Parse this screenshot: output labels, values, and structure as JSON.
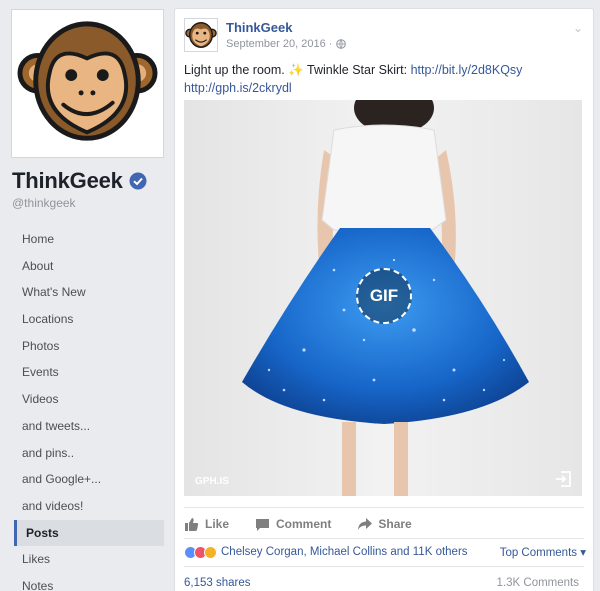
{
  "page": {
    "name": "ThinkGeek",
    "handle": "@thinkgeek"
  },
  "nav": {
    "items": [
      "Home",
      "About",
      "What's New",
      "Locations",
      "Photos",
      "Events",
      "Videos",
      "and tweets...",
      "and pins..",
      "and Google+...",
      "and videos!",
      "Posts",
      "Likes",
      "Notes"
    ],
    "active": "Posts"
  },
  "post": {
    "author": "ThinkGeek",
    "date": "September 20, 2016 ·",
    "text_before": "Light up the room. ",
    "emoji": "✨",
    "text_middle": " Twinkle Star Skirt: ",
    "link1": "http://bit.ly/2d8KQsy",
    "link2": "http://gph.is/2ckrydl",
    "media_badge": "GIF",
    "media_source": "GPH.IS"
  },
  "actions": {
    "like": "Like",
    "comment": "Comment",
    "share": "Share"
  },
  "reactions": {
    "summary": "Chelsey Corgan, Michael Collins and 11K others",
    "top_comments": "Top Comments ▾",
    "shares": "6,153 shares",
    "comments": "1.3K Comments"
  },
  "colors": {
    "brand_blue": "#4267b2",
    "link_blue": "#365899",
    "like_blue": "#5890ff",
    "love_red": "#f25268",
    "wow_yellow": "#f7b125"
  }
}
